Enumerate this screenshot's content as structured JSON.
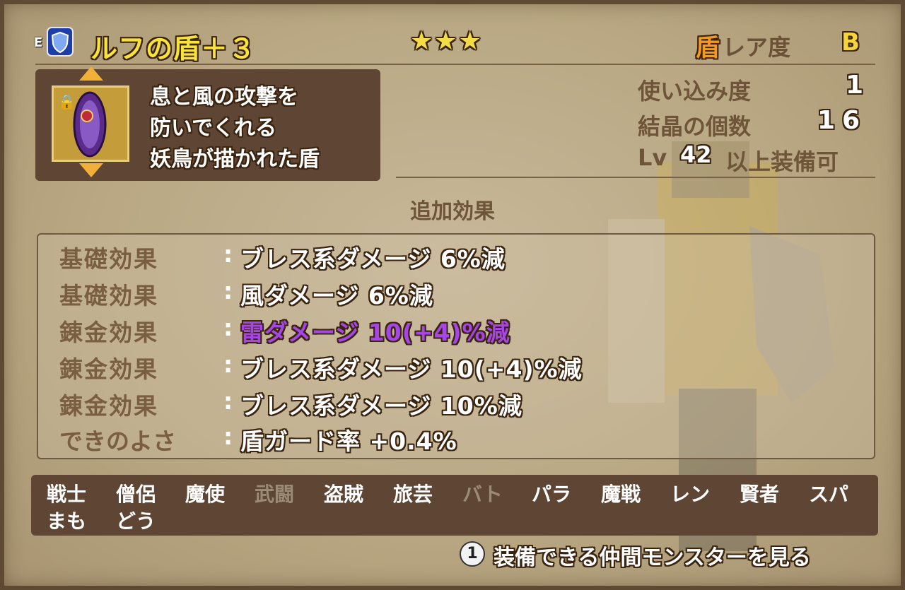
{
  "item": {
    "equipped_mark": "E",
    "name": "ルフの盾＋３",
    "stars": "★★★",
    "category": "盾",
    "rarity_label": "レア度",
    "rarity": "B",
    "description": [
      "息と風の攻撃を",
      "防いでくれる",
      "妖鳥が描かれた盾"
    ]
  },
  "stats": {
    "usage_label": "使い込み度",
    "usage_value": "1",
    "crystal_label": "結晶の個数",
    "crystal_value": "16",
    "level_prefix": "Lv",
    "level_value": "42",
    "level_suffix": "以上装備可"
  },
  "effects": {
    "heading": "追加効果",
    "separator": ":",
    "rows": [
      {
        "type": "基礎効果",
        "value": "ブレス系ダメージ 6%減"
      },
      {
        "type": "基礎効果",
        "value": "風ダメージ 6%減"
      },
      {
        "type": "錬金効果",
        "value": "雷ダメージ 10(+4)%減"
      },
      {
        "type": "錬金効果",
        "value": "ブレス系ダメージ 10(+4)%減"
      },
      {
        "type": "錬金効果",
        "value": "ブレス系ダメージ 10%減"
      },
      {
        "type": "できのよさ",
        "value": "盾ガード率 +0.4%"
      }
    ]
  },
  "jobs": [
    "戦士",
    "僧侶",
    "魔使",
    "武闘",
    "盗賊",
    "旅芸",
    "バト",
    "パラ",
    "魔戦",
    "レン",
    "賢者",
    "スパ",
    "まも",
    "どう"
  ],
  "hint": {
    "button": "1",
    "text": "装備できる仲間モンスターを見る"
  },
  "colors": {
    "item_name": "#f7e33a",
    "highlight_effect": "#a646e6",
    "rarity": "#f7d43a",
    "category": "#f39b20"
  }
}
